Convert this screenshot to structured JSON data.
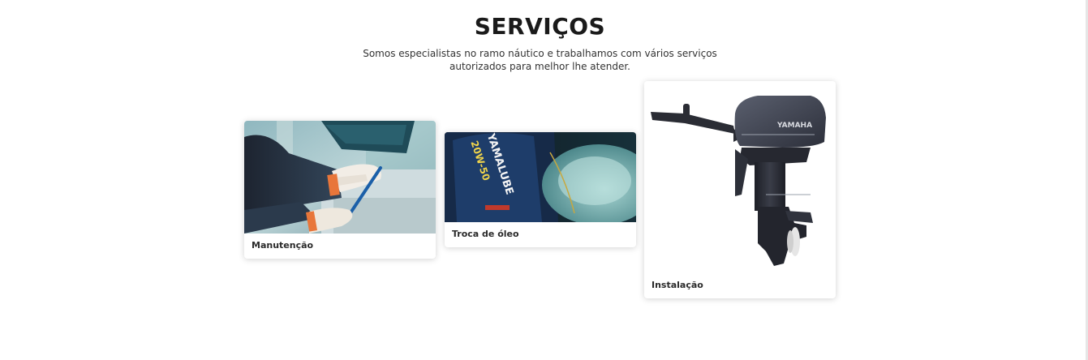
{
  "section": {
    "title": "SERVIÇOS",
    "subtitle": "Somos especialistas no ramo náutico e trabalhamos com vários serviços autorizados para melhor lhe atender."
  },
  "cards": [
    {
      "label": "Manutenção",
      "image": "mechanic-hands-maintenance-photo"
    },
    {
      "label": "Troca de óleo",
      "image": "yamalube-oil-bottle-photo"
    },
    {
      "label": "Instalação",
      "image": "yamaha-outboard-motor-photo"
    }
  ],
  "brand": {
    "motor_logo": "YAMAHA",
    "oil_brand": "YAMALUBE",
    "oil_grade": "20W-50"
  }
}
